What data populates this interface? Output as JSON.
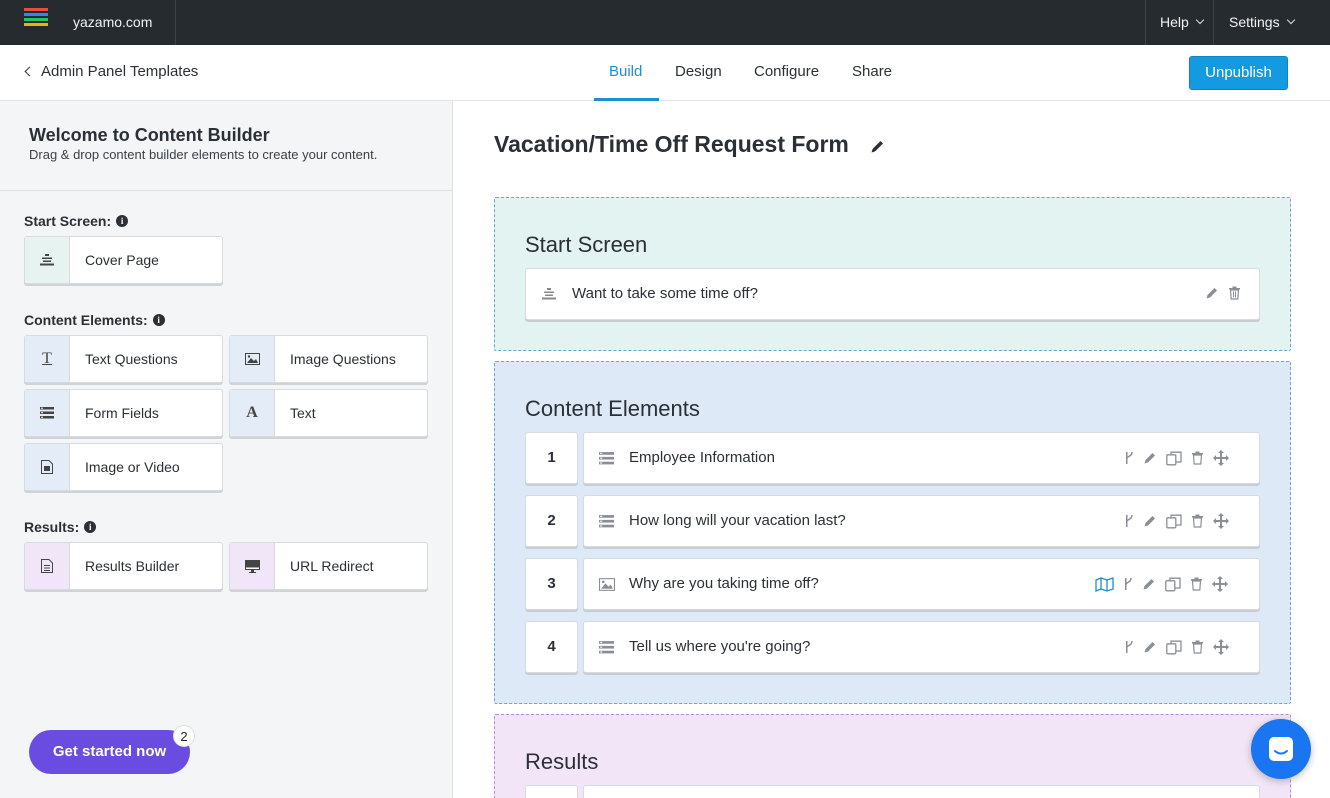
{
  "topbar": {
    "site": "yazamo.com",
    "help": "Help",
    "settings": "Settings",
    "logo_colors": [
      "#e84c3d",
      "#3b82f6",
      "#22c55e",
      "#eab308"
    ]
  },
  "nav": {
    "back_label": "Admin Panel Templates",
    "tabs": [
      "Build",
      "Design",
      "Configure",
      "Share"
    ],
    "active_tab": "Build",
    "unpublish": "Unpublish"
  },
  "sidebar": {
    "welcome_title": "Welcome to Content Builder",
    "welcome_sub": "Drag & drop content builder elements to create your content.",
    "start_label": "Start Screen:",
    "start_items": [
      {
        "label": "Cover Page",
        "icon": "align-center-icon"
      }
    ],
    "content_label": "Content Elements:",
    "content_items": [
      {
        "label": "Text Questions",
        "icon": "text-icon"
      },
      {
        "label": "Image Questions",
        "icon": "image-icon"
      },
      {
        "label": "Form Fields",
        "icon": "list-icon"
      },
      {
        "label": "Text",
        "icon": "font-icon"
      },
      {
        "label": "Image or Video",
        "icon": "file-image-icon"
      }
    ],
    "results_label": "Results:",
    "results_items": [
      {
        "label": "Results Builder",
        "icon": "file-text-icon"
      },
      {
        "label": "URL Redirect",
        "icon": "monitor-icon"
      }
    ],
    "get_started": "Get started now",
    "badge": "2"
  },
  "main": {
    "form_title": "Vacation/Time Off Request Form",
    "start_zone_title": "Start Screen",
    "start_item": "Want to take some time off?",
    "content_zone_title": "Content Elements",
    "elements": [
      {
        "num": "1",
        "label": "Employee Information",
        "icon": "list-icon"
      },
      {
        "num": "2",
        "label": "How long will your vacation last?",
        "icon": "list-icon"
      },
      {
        "num": "3",
        "label": "Why are you taking time off?",
        "icon": "image-icon"
      },
      {
        "num": "4",
        "label": "Tell us where you're going?",
        "icon": "list-icon"
      }
    ],
    "results_zone_title": "Results"
  },
  "colors": {
    "accent": "#1b8fd1",
    "button": "#149ae0",
    "cta": "#6a4ce0",
    "chat": "#1a76f0"
  }
}
